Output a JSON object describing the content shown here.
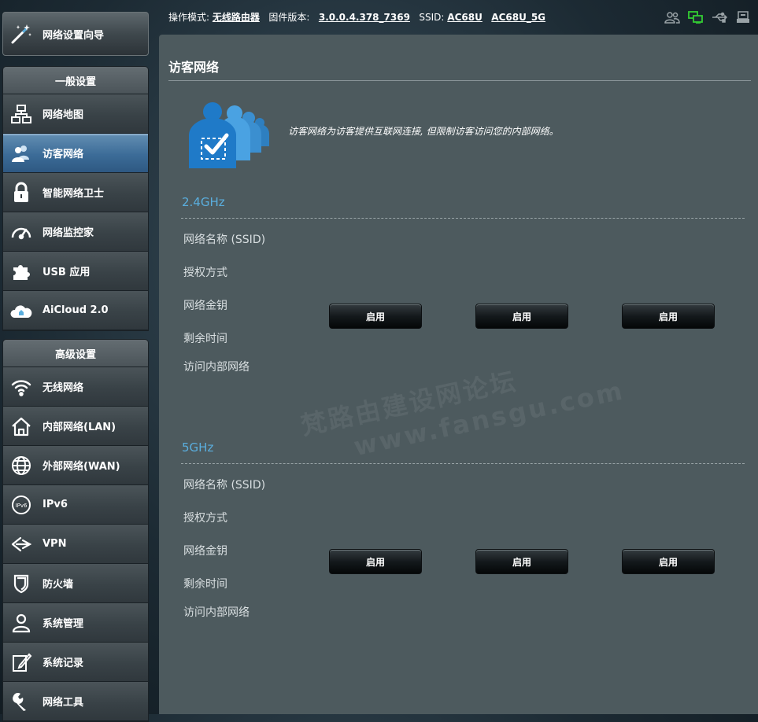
{
  "wizard": {
    "label": "网络设置向导",
    "icon": "magic-wand-icon"
  },
  "general": {
    "header": "一般设置",
    "items": [
      {
        "label": "网络地图",
        "icon": "network-map-icon",
        "active": false
      },
      {
        "label": "访客网络",
        "icon": "guest-network-icon",
        "active": true
      },
      {
        "label": "智能网络卫士",
        "icon": "lock-icon",
        "active": false
      },
      {
        "label": "网络监控家",
        "icon": "speedometer-icon",
        "active": false
      },
      {
        "label": "USB 应用",
        "icon": "puzzle-icon",
        "active": false
      },
      {
        "label": "AiCloud 2.0",
        "icon": "cloud-home-icon",
        "active": false
      }
    ]
  },
  "advanced": {
    "header": "高级设置",
    "items": [
      {
        "label": "无线网络",
        "icon": "wifi-icon"
      },
      {
        "label": "内部网络(LAN)",
        "icon": "home-icon"
      },
      {
        "label": "外部网络(WAN)",
        "icon": "globe-icon"
      },
      {
        "label": "IPv6",
        "icon": "ipv6-icon"
      },
      {
        "label": "VPN",
        "icon": "vpn-icon"
      },
      {
        "label": "防火墙",
        "icon": "shield-icon"
      },
      {
        "label": "系统管理",
        "icon": "user-admin-icon"
      },
      {
        "label": "系统记录",
        "icon": "log-edit-icon"
      },
      {
        "label": "网络工具",
        "icon": "wrench-icon"
      }
    ]
  },
  "topbar": {
    "mode_label": "操作模式:",
    "mode_value": "无线路由器",
    "firmware_label": "固件版本:",
    "firmware_value": "3.0.0.4.378_7369",
    "ssid_label": "SSID:",
    "ssid_24": "AC68U",
    "ssid_5": "AC68U_5G",
    "status_icons": [
      "clients-icon",
      "network-status-icon",
      "usb-icon",
      "printer-icon"
    ],
    "accent_color": "#33cc33"
  },
  "main": {
    "title": "访客网络",
    "description": "访客网络为访客提供互联网连接, 但限制访客访问您的内部网络。",
    "watermark_line1": "梵路由建设网论坛",
    "watermark_line2": "www.fansgu.com",
    "bands": [
      {
        "title": "2.4GHz",
        "fields": [
          "网络名称 (SSID)",
          "授权方式",
          "网络金钥",
          "剩余时间",
          "访问内部网络"
        ],
        "buttons": [
          "启用",
          "启用",
          "启用"
        ]
      },
      {
        "title": "5GHz",
        "fields": [
          "网络名称 (SSID)",
          "授权方式",
          "网络金钥",
          "剩余时间",
          "访问内部网络"
        ],
        "buttons": [
          "启用",
          "启用",
          "启用"
        ]
      }
    ]
  }
}
